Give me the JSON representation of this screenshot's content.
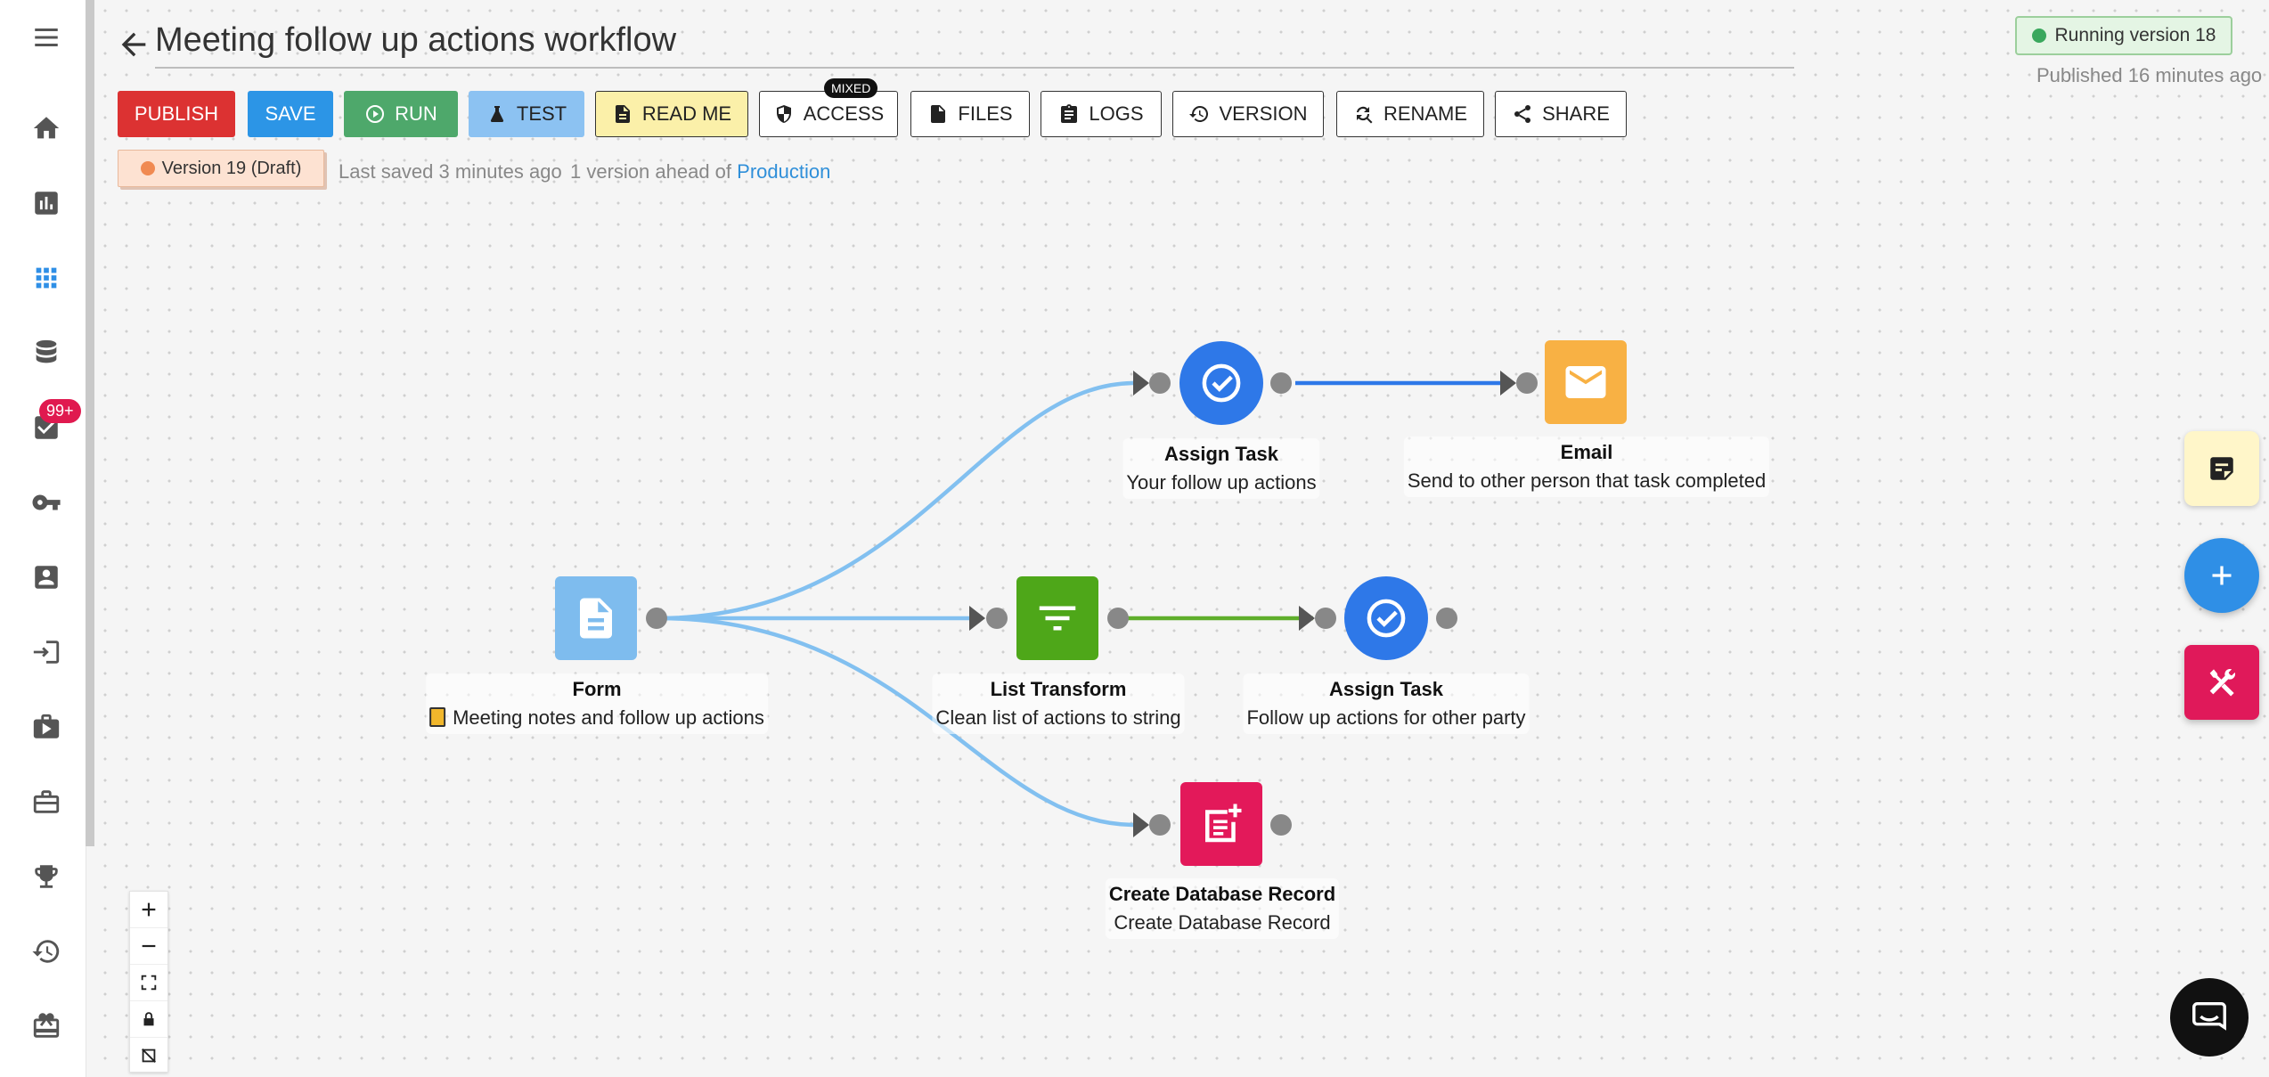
{
  "header": {
    "title": "Meeting follow up actions workflow",
    "running_badge": "Running version 18",
    "published": "Published 16 minutes ago"
  },
  "toolbar": {
    "publish": "PUBLISH",
    "save": "SAVE",
    "run": "RUN",
    "test": "TEST",
    "readme": "READ ME",
    "access": "ACCESS",
    "access_badge": "MIXED",
    "files": "FILES",
    "logs": "LOGS",
    "version": "VERSION",
    "rename": "RENAME",
    "share": "SHARE"
  },
  "status": {
    "version_chip": "Version 19 (Draft)",
    "last_saved": "Last saved 3 minutes ago",
    "ahead": "1 version ahead of",
    "production": "Production"
  },
  "sidebar": {
    "badge": "99+",
    "icons": [
      "menu-icon",
      "home-icon",
      "analytics-icon",
      "apps-grid-icon",
      "database-icon",
      "tasks-icon",
      "key-icon",
      "contact-card-icon",
      "login-icon",
      "video-case-icon",
      "briefcase-icon",
      "trophy-icon",
      "history-icon",
      "gift-icon"
    ]
  },
  "nodes": [
    {
      "id": "form",
      "title": "Form",
      "subtitle": "Meeting notes and follow up actions",
      "icon": "document-icon"
    },
    {
      "id": "assign1",
      "title": "Assign Task",
      "subtitle": "Your follow up actions",
      "icon": "check-circle-icon"
    },
    {
      "id": "email",
      "title": "Email",
      "subtitle": "Send to other person that task completed",
      "icon": "mail-icon"
    },
    {
      "id": "listtransform",
      "title": "List Transform",
      "subtitle": "Clean list of actions to string",
      "icon": "filter-icon"
    },
    {
      "id": "assign2",
      "title": "Assign Task",
      "subtitle": "Follow up actions for other party",
      "icon": "check-circle-icon"
    },
    {
      "id": "createdb",
      "title": "Create Database Record",
      "subtitle": "Create Database Record",
      "icon": "note-add-icon"
    }
  ],
  "colors": {
    "publish": "#dc3232",
    "save": "#2c95e6",
    "run": "#4ea86b",
    "test": "#8cc2f2",
    "readme": "#fbf0a9",
    "form": "#7ebcee",
    "assign": "#2e78e8",
    "email": "#f8b144",
    "transform": "#4ea719",
    "createdb": "#e3195a"
  }
}
